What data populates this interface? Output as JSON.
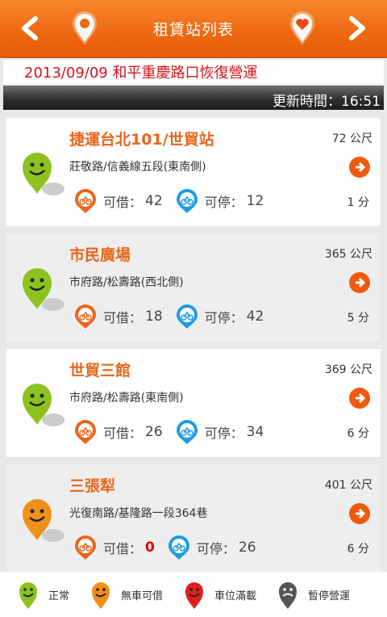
{
  "header": {
    "title": "租賃站列表",
    "back_icon": "chevron-left-icon",
    "location_icon": "map-pin-icon",
    "favorite_icon": "heart-pin-icon",
    "forward_icon": "chevron-right-icon",
    "bg_color": "#ee6a12"
  },
  "notice": "2013/09/09 和平重慶路口恢復營運",
  "updated": "更新時間：16:51",
  "stations": [
    {
      "name": "捷運台北101/世貿站",
      "distance": "72 公尺",
      "address": "莊敬路/信義線五段(東南側)",
      "borrow_label": "可借：",
      "borrow": "42",
      "return_label": "可停：",
      "return": "12",
      "minutes": "1 分",
      "status": "normal"
    },
    {
      "name": "市民廣場",
      "distance": "365 公尺",
      "address": "市府路/松壽路(西北側)",
      "borrow_label": "可借：",
      "borrow": "18",
      "return_label": "可停：",
      "return": "42",
      "minutes": "5 分",
      "status": "normal"
    },
    {
      "name": "世貿三館",
      "distance": "369 公尺",
      "address": "市府路/松壽路(東南側)",
      "borrow_label": "可借：",
      "borrow": "26",
      "return_label": "可停：",
      "return": "34",
      "minutes": "6 分",
      "status": "normal"
    },
    {
      "name": "三張犁",
      "distance": "401 公尺",
      "address": "光復南路/基隆路一段364巷",
      "borrow_label": "可借：",
      "borrow": "0",
      "return_label": "可停：",
      "return": "26",
      "minutes": "6 分",
      "status": "no-bike"
    }
  ],
  "legend": [
    {
      "label": "正常",
      "color": "#8cc21e"
    },
    {
      "label": "無車可借",
      "color": "#f0901a"
    },
    {
      "label": "車位滿載",
      "color": "#e02020"
    },
    {
      "label": "暫停營運",
      "color": "#555555"
    }
  ],
  "colors": {
    "orange": "#e8661b",
    "blue": "#1e9be6",
    "green": "#8cc21e"
  }
}
